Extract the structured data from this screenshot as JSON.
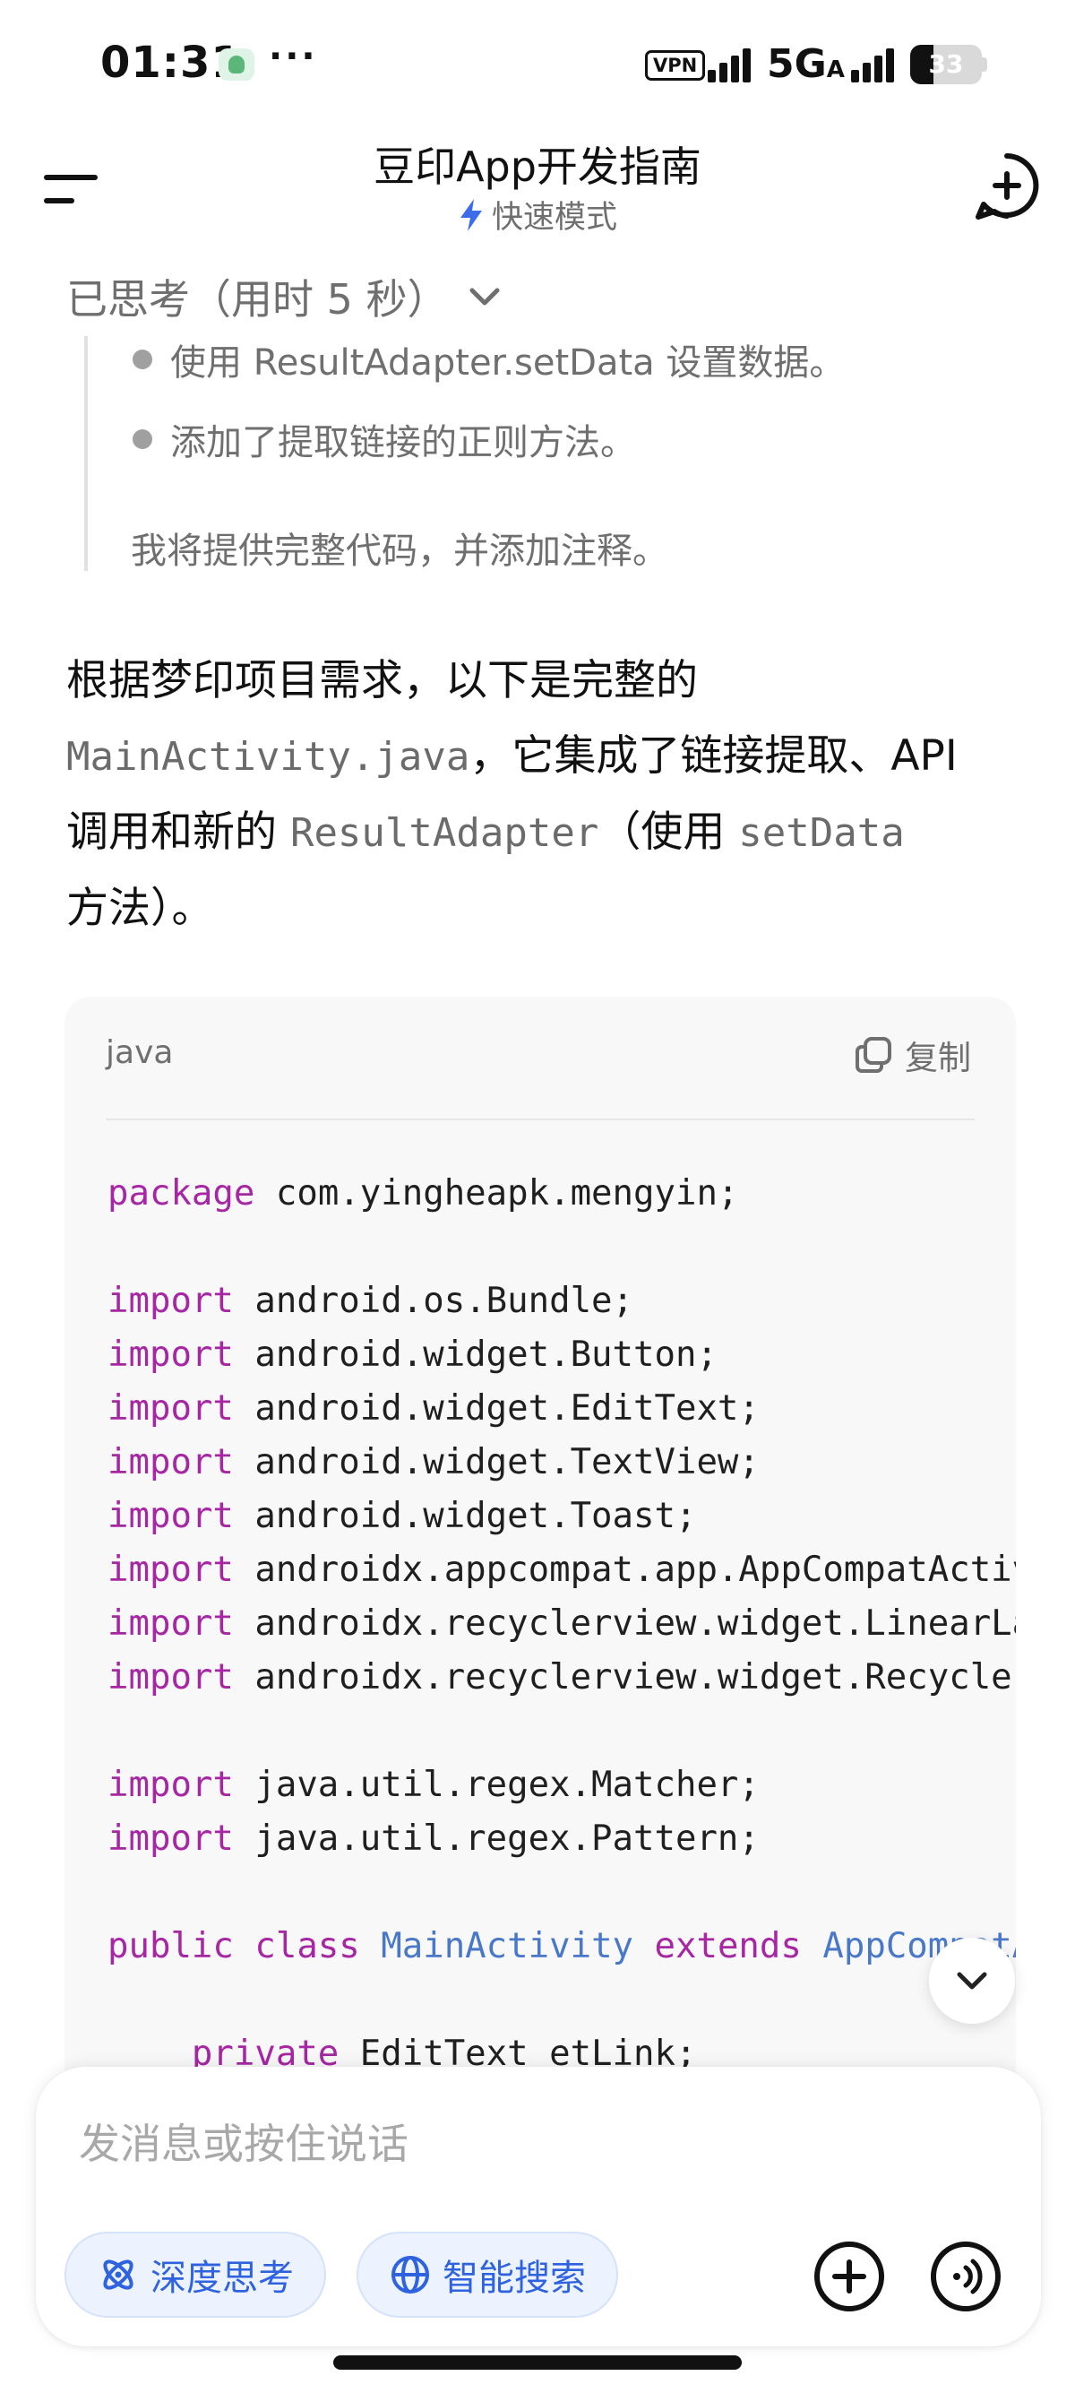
{
  "status_bar": {
    "time": "01:31",
    "dots": "···",
    "vpn": "VPN",
    "network": "5G",
    "network_sub": "A",
    "battery": "33",
    "battery_level": 0.33
  },
  "header": {
    "title": "豆印App开发指南",
    "mode": "快速模式"
  },
  "thinking": {
    "toggle_label": "已思考（用时 5 秒）",
    "bullets": [
      "使用 ResultAdapter.setData 设置数据。",
      "添加了提取链接的正则方法。"
    ],
    "summary": "我将提供完整代码，并添加注释。"
  },
  "answer": {
    "part1": "根据梦印项目需求，以下是完整的",
    "code1": "MainActivity.java",
    "part2": "，它集成了链接提取、API",
    "part3": "调用和新的",
    "code2": "ResultAdapter",
    "part4": "（使用",
    "code3": "setData",
    "part5": "方法）。"
  },
  "code_block": {
    "language": "java",
    "copy_label": "复制",
    "lines": [
      {
        "kw": "package",
        "rest": " com.yingheapk.mengyin;"
      },
      {
        "kw": "import",
        "rest": " android.os.Bundle;"
      },
      {
        "kw": "import",
        "rest": " android.widget.Button;"
      },
      {
        "kw": "import",
        "rest": " android.widget.EditText;"
      },
      {
        "kw": "import",
        "rest": " android.widget.TextView;"
      },
      {
        "kw": "import",
        "rest": " android.widget.Toast;"
      },
      {
        "kw": "import",
        "rest": " androidx.appcompat.app.AppCompatActiv"
      },
      {
        "kw": "import",
        "rest": " androidx.recyclerview.widget.LinearLa"
      },
      {
        "kw": "import",
        "rest": " androidx.recyclerview.widget.Recycler"
      },
      {
        "kw": "import",
        "rest": " java.util.regex.Matcher;"
      },
      {
        "kw": "import",
        "rest": " java.util.regex.Pattern;"
      },
      {
        "kw1": "public",
        "kw2": "class",
        "type1": "MainActivity",
        "kw3": "extends",
        "type2": "AppCompatA"
      },
      {
        "kw": "private",
        "rest": " EditText etLink;"
      }
    ]
  },
  "composer": {
    "placeholder": "发消息或按住说话",
    "deep_think": "深度思考",
    "smart_search": "智能搜索"
  },
  "colors": {
    "accent": "#2f62de",
    "chip_bg": "#edf3fe",
    "keyword": "#a626a4",
    "type": "#4a78c9",
    "muted": "#6f6f6f"
  },
  "icons": [
    "menu-icon",
    "lightning-icon",
    "new-chat-icon",
    "chevron-down-icon",
    "copy-icon",
    "scroll-down-icon",
    "atom-icon",
    "globe-icon",
    "plus-icon",
    "voice-icon"
  ]
}
